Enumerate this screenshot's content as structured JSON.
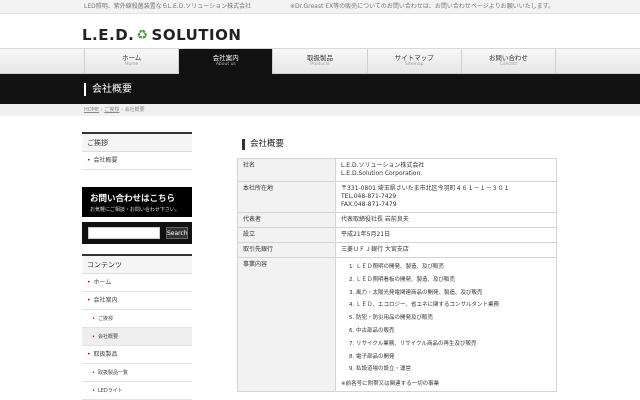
{
  "topbar": {
    "left_text": "LED照明、紫外線殺菌装置ならL.E.D.ソリューション株式会社",
    "right_text": "※Dr.Greast EX等の販売についてのお問い合わせは、お問い合わせページよりお願いいたします。"
  },
  "logo": {
    "left": "L.E.D.",
    "icon": "recycle-icon",
    "right": "SOLUTION",
    "icon_glyph": "♻"
  },
  "nav": [
    {
      "jp": "ホーム",
      "en": "Home",
      "active": false
    },
    {
      "jp": "会社案内",
      "en": "About us",
      "active": true
    },
    {
      "jp": "取扱製品",
      "en": "Products",
      "active": false
    },
    {
      "jp": "サイトマップ",
      "en": "Sitemap",
      "active": false
    },
    {
      "jp": "お問い合わせ",
      "en": "Contact",
      "active": false
    }
  ],
  "page_title": "会社概要",
  "breadcrumb": {
    "home": "HOME",
    "sep1": "›",
    "parent": "ご挨拶",
    "sep2": "›",
    "current": "会社概要"
  },
  "sidebar": {
    "greeting_head": "ご挨拶",
    "greeting_item": "会社概要",
    "contact_line1": "お問い合わせはこちら",
    "contact_line2": "お気軽にご相談・お問い合わせ下さい。",
    "search_placeholder": "",
    "search_button": "Search",
    "contents_head": "コンテンツ",
    "contents_items": [
      {
        "label": "ホーム",
        "level": 1
      },
      {
        "label": "会社案内",
        "level": 1
      },
      {
        "label": "ご挨拶",
        "level": 2
      },
      {
        "label": "会社概要",
        "level": 2
      },
      {
        "label": "取扱製品",
        "level": 1
      },
      {
        "label": "取扱製品一覧",
        "level": 2
      },
      {
        "label": "LEDライト",
        "level": 2
      }
    ]
  },
  "main": {
    "heading": "会社概要",
    "rows": {
      "company_key": "社名",
      "company_val1": "L.E.D.ソリューション株式会社",
      "company_val2": "L.E.D.Solution Corporation.",
      "address_key": "本社所在地",
      "address_val1": "〒331-0801 埼玉県さいたま市北区今羽町４６１－１－３０１",
      "address_val2": "TEL.048-871-7429",
      "address_val3": "FAX.048-871-7479",
      "rep_key": "代表者",
      "rep_val": "代表取締役社長 岩前良夫",
      "est_key": "設立",
      "est_val": "平成21年5月21日",
      "bank_key": "取引先銀行",
      "bank_val": "三菱ＵＦＪ銀行 大宮支店",
      "biz_key": "事業内容",
      "biz_items": [
        "1. ＬＥＤ照明の開発、製造、及び販売",
        "2. ＬＥＤ照明看板の開発、製造、及び販売",
        "3. 風力・太陽光発電関連商品の開発、製造、及び販売",
        "4. ＬＥＤ、エコロジー、省エネに関するコンサルタント業務",
        "5. 防犯・防災用品の開発及び販売",
        "6. 中古部品の販売",
        "7. リサイクル業務、リサイクル商品の再生及び販売",
        "8. 電子部品の開発",
        "9. 私設道場の設立・運営"
      ],
      "biz_note": "※前各号に附帯又は関連する一切の事業"
    }
  }
}
